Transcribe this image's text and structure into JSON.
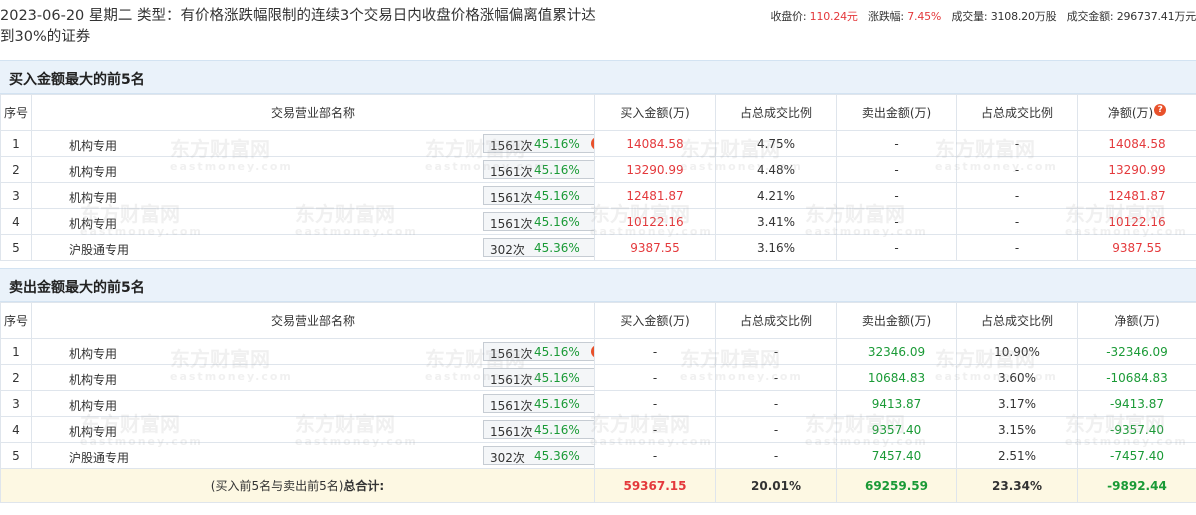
{
  "header": {
    "title": "2023-06-20 星期二 类型：有价格涨跌幅限制的连续3个交易日内收盘价格涨幅偏离值累计达到30%的证券",
    "close_label": "收盘价:",
    "close_value": "110.24元",
    "change_label": "涨跌幅:",
    "change_value": "7.45%",
    "volume_label": "成交量:",
    "volume_value": "3108.20万股",
    "turnover_label": "成交金额:",
    "turnover_value": "296737.41万元"
  },
  "columns": {
    "idx": "序号",
    "dept": "交易营业部名称",
    "buy": "买入金额(万)",
    "buy_ratio": "占总成交比例",
    "sell": "卖出金额(万)",
    "sell_ratio": "占总成交比例",
    "net": "净额(万)"
  },
  "buy_section": {
    "title": "买入金额最大的前5名",
    "rows": [
      {
        "idx": "1",
        "name": "机构专用",
        "count": "1561次",
        "pct": "45.16%",
        "buy": "14084.58",
        "buy_ratio": "4.75%",
        "sell": "-",
        "sell_ratio": "-",
        "net": "14084.58"
      },
      {
        "idx": "2",
        "name": "机构专用",
        "count": "1561次",
        "pct": "45.16%",
        "buy": "13290.99",
        "buy_ratio": "4.48%",
        "sell": "-",
        "sell_ratio": "-",
        "net": "13290.99"
      },
      {
        "idx": "3",
        "name": "机构专用",
        "count": "1561次",
        "pct": "45.16%",
        "buy": "12481.87",
        "buy_ratio": "4.21%",
        "sell": "-",
        "sell_ratio": "-",
        "net": "12481.87"
      },
      {
        "idx": "4",
        "name": "机构专用",
        "count": "1561次",
        "pct": "45.16%",
        "buy": "10122.16",
        "buy_ratio": "3.41%",
        "sell": "-",
        "sell_ratio": "-",
        "net": "10122.16"
      },
      {
        "idx": "5",
        "name": "沪股通专用",
        "count": "302次",
        "pct": "45.36%",
        "buy": "9387.55",
        "buy_ratio": "3.16%",
        "sell": "-",
        "sell_ratio": "-",
        "net": "9387.55"
      }
    ]
  },
  "sell_section": {
    "title": "卖出金额最大的前5名",
    "rows": [
      {
        "idx": "1",
        "name": "机构专用",
        "count": "1561次",
        "pct": "45.16%",
        "buy": "-",
        "buy_ratio": "-",
        "sell": "32346.09",
        "sell_ratio": "10.90%",
        "net": "-32346.09"
      },
      {
        "idx": "2",
        "name": "机构专用",
        "count": "1561次",
        "pct": "45.16%",
        "buy": "-",
        "buy_ratio": "-",
        "sell": "10684.83",
        "sell_ratio": "3.60%",
        "net": "-10684.83"
      },
      {
        "idx": "3",
        "name": "机构专用",
        "count": "1561次",
        "pct": "45.16%",
        "buy": "-",
        "buy_ratio": "-",
        "sell": "9413.87",
        "sell_ratio": "3.17%",
        "net": "-9413.87"
      },
      {
        "idx": "4",
        "name": "机构专用",
        "count": "1561次",
        "pct": "45.16%",
        "buy": "-",
        "buy_ratio": "-",
        "sell": "9357.40",
        "sell_ratio": "3.15%",
        "net": "-9357.40"
      },
      {
        "idx": "5",
        "name": "沪股通专用",
        "count": "302次",
        "pct": "45.36%",
        "buy": "-",
        "buy_ratio": "-",
        "sell": "7457.40",
        "sell_ratio": "2.51%",
        "net": "-7457.40"
      }
    ]
  },
  "total": {
    "label_prefix": "(买入前5名与卖出前5名)",
    "label_bold": "总合计:",
    "buy": "59367.15",
    "buy_ratio": "20.01%",
    "sell": "69259.59",
    "sell_ratio": "23.34%",
    "net": "-9892.44"
  },
  "watermark": {
    "cn": "东方财富网",
    "en": "eastmoney.com"
  },
  "colors": {
    "up": "#e4393c",
    "down": "#1a9a36",
    "section_bg": "#eaf2fa",
    "total_bg": "#fdf8e3"
  },
  "icons": {
    "help": "question-circle-icon",
    "expand": "triangle-right-icon"
  }
}
